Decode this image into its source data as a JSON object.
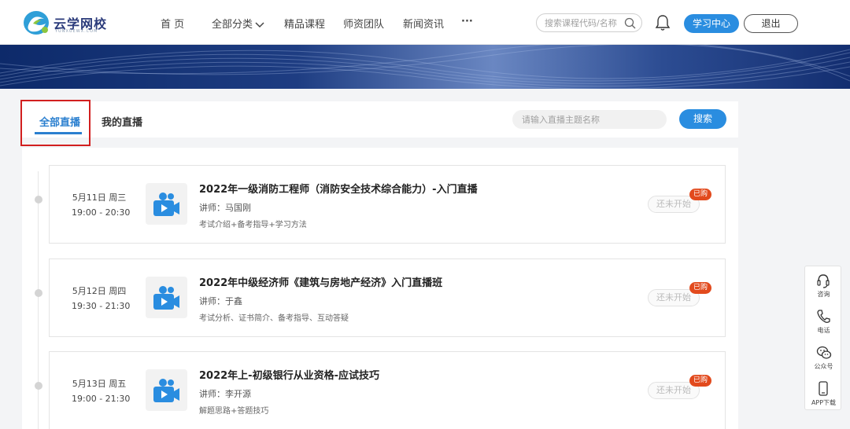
{
  "header": {
    "logo_text": "云学网校",
    "logo_sub": "YUNXUEWX.COM",
    "nav": [
      {
        "label": "首 页"
      },
      {
        "label": "全部分类"
      },
      {
        "label": "精品课程"
      },
      {
        "label": "师资团队"
      },
      {
        "label": "新闻资讯"
      },
      {
        "label": "···"
      }
    ],
    "search_placeholder": "搜索课程代码/名称",
    "study_center": "学习中心",
    "logout": "退出"
  },
  "tabs": {
    "all_live": "全部直播",
    "my_live": "我的直播",
    "search_placeholder": "请输入直播主题名称",
    "search_button": "搜索"
  },
  "live_list": [
    {
      "date": "5月11日 周三",
      "time": "19:00 - 20:30",
      "title": "2022年一级消防工程师（消防安全技术综合能力）-入门直播",
      "teacher": "讲师：马国刚",
      "desc": "考试介绍+备考指导+学习方法",
      "status": "还未开始",
      "badge": "已购"
    },
    {
      "date": "5月12日 周四",
      "time": "19:30 - 21:30",
      "title": "2022年中级经济师《建筑与房地产经济》入门直播班",
      "teacher": "讲师：于鑫",
      "desc": "考试分析、证书简介、备考指导、互动答疑",
      "status": "还未开始",
      "badge": "已购"
    },
    {
      "date": "5月13日 周五",
      "time": "19:00 - 21:30",
      "title": "2022年上-初级银行从业资格-应试技巧",
      "teacher": "讲师：李开源",
      "desc": "解题思路+答题技巧",
      "status": "还未开始",
      "badge": "已购"
    }
  ],
  "float_bar": [
    {
      "label": "咨询",
      "icon": "headset-icon"
    },
    {
      "label": "电话",
      "icon": "phone-icon"
    },
    {
      "label": "公众号",
      "icon": "wechat-icon"
    },
    {
      "label": "APP下载",
      "icon": "mobile-icon"
    }
  ],
  "colors": {
    "accent": "#2a8de0",
    "active_tab": "#2a7fcf",
    "badge": "#e24a1d",
    "highlight_box": "#d21f1f",
    "banner": "#1e3d82"
  }
}
